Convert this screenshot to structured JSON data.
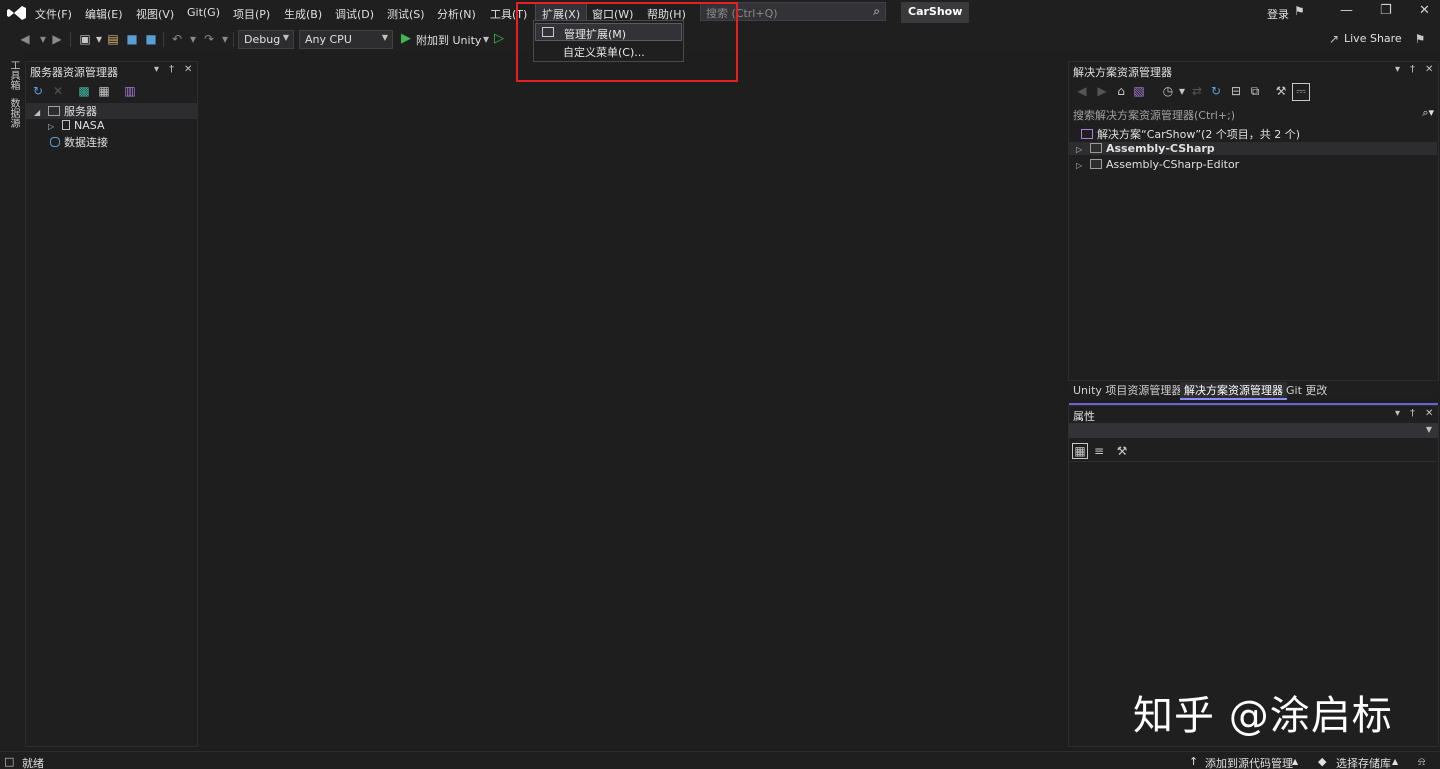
{
  "menubar": {
    "items": [
      "文件(F)",
      "编辑(E)",
      "视图(V)",
      "Git(G)",
      "项目(P)",
      "生成(B)",
      "调试(D)",
      "测试(S)",
      "分析(N)",
      "工具(T)",
      "扩展(X)",
      "窗口(W)",
      "帮助(H)"
    ],
    "search_placeholder": "搜索 (Ctrl+Q)",
    "solution_badge": "CarShow",
    "login": "登录"
  },
  "toolbar": {
    "config": "Debug",
    "platform": "Any CPU",
    "attach": "附加到 Unity",
    "live_share": "Live Share"
  },
  "left_strip": {
    "tab1": "工具箱",
    "tab2": "数据源"
  },
  "server_explorer": {
    "title": "服务器资源管理器",
    "root": "服务器",
    "child": "NASA",
    "data_conn": "数据连接"
  },
  "extensions_menu": {
    "items": [
      {
        "label": "管理扩展(M)"
      },
      {
        "label": "自定义菜单(C)..."
      }
    ]
  },
  "solution_explorer": {
    "title": "解决方案资源管理器",
    "search_placeholder": "搜索解决方案资源管理器(Ctrl+;)",
    "solution": "解决方案“CarShow”(2 个项目，共 2 个)",
    "projects": [
      "Assembly-CSharp",
      "Assembly-CSharp-Editor"
    ],
    "tabs": [
      "Unity 项目资源管理器",
      "解决方案资源管理器",
      "Git 更改"
    ]
  },
  "properties": {
    "title": "属性"
  },
  "statusbar": {
    "ready": "就绪",
    "add_source": "添加到源代码管理",
    "select_repo": "选择存储库"
  },
  "watermark": "知乎 @涂启标",
  "colors": {
    "background": "#1e1e1e",
    "highlight_box": "#e52020",
    "play_green": "#3fb950",
    "accent_purple": "#6b5fd3"
  }
}
